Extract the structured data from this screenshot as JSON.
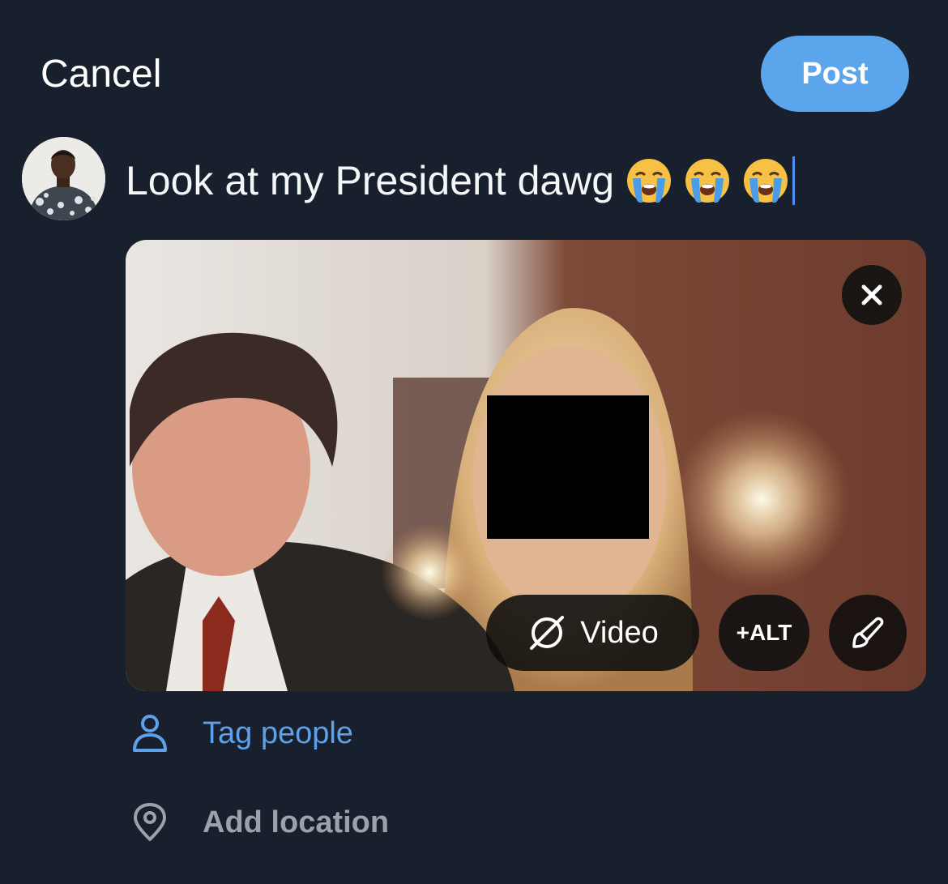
{
  "header": {
    "cancel_label": "Cancel",
    "post_label": "Post"
  },
  "compose": {
    "text": "Look at my President dawg",
    "emoji": [
      "loudly-crying-face",
      "loudly-crying-face",
      "loudly-crying-face"
    ]
  },
  "media": {
    "close_icon": "close-icon",
    "video_label": "Video",
    "alt_label": "+ALT",
    "edit_icon": "brush-icon"
  },
  "options": {
    "tag_people": "Tag people",
    "add_location": "Add location"
  },
  "colors": {
    "background": "#17202c",
    "accent": "#5aa5ec",
    "link": "#5ea1ea",
    "muted": "#9aa3ac"
  }
}
